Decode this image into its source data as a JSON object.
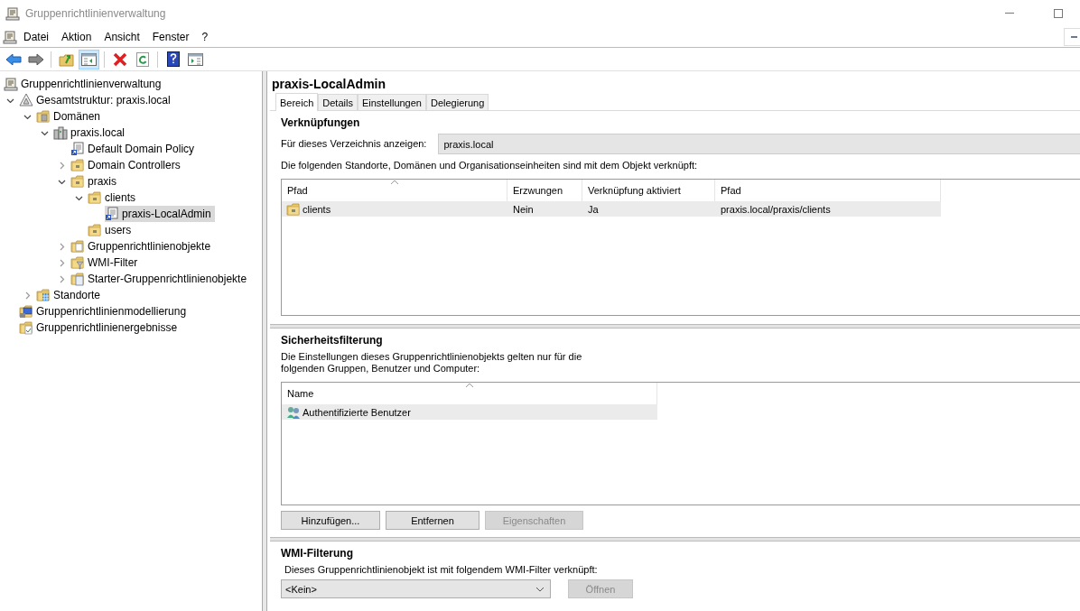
{
  "window": {
    "title": "Gruppenrichtlinienverwaltung"
  },
  "menu": [
    "Datei",
    "Aktion",
    "Ansicht",
    "Fenster",
    "?"
  ],
  "toolbar": [
    {
      "kind": "back",
      "pressed": false
    },
    {
      "kind": "forward",
      "pressed": false
    },
    {
      "kind": "up",
      "pressed": false
    },
    {
      "kind": "tree",
      "pressed": true
    },
    {
      "kind": "delete",
      "pressed": false
    },
    {
      "kind": "refresh",
      "pressed": false
    },
    {
      "kind": "help",
      "pressed": false
    },
    {
      "kind": "pane",
      "pressed": false
    }
  ],
  "tree": {
    "items": [
      {
        "label": "Gruppenrichtlinienverwaltung",
        "kind": "console",
        "selected": false,
        "children": [
          {
            "label": "Gesamtstruktur: praxis.local",
            "kind": "forest",
            "expanded": true,
            "selected": false,
            "children": [
              {
                "label": "Domänen",
                "kind": "domains",
                "expanded": true,
                "selected": false,
                "children": [
                  {
                    "label": "praxis.local",
                    "kind": "domain",
                    "expanded": true,
                    "selected": false,
                    "children": [
                      {
                        "label": "Default Domain Policy",
                        "kind": "link",
                        "selected": false
                      },
                      {
                        "label": "Domain Controllers",
                        "kind": "ou",
                        "expanded": false,
                        "selected": false
                      },
                      {
                        "label": "praxis",
                        "kind": "ou",
                        "expanded": true,
                        "selected": false,
                        "children": [
                          {
                            "label": "clients",
                            "kind": "ou",
                            "expanded": true,
                            "selected": false,
                            "children": [
                              {
                                "label": "praxis-LocalAdmin",
                                "kind": "link",
                                "selected": true
                              }
                            ]
                          },
                          {
                            "label": "users",
                            "kind": "ou",
                            "selected": false
                          }
                        ]
                      },
                      {
                        "label": "Gruppenrichtlinienobjekte",
                        "kind": "gpos",
                        "expanded": false,
                        "selected": false
                      },
                      {
                        "label": "WMI-Filter",
                        "kind": "wmi",
                        "expanded": false,
                        "selected": false
                      },
                      {
                        "label": "Starter-Gruppenrichtlinienobjekte",
                        "kind": "starter",
                        "expanded": false,
                        "selected": false
                      }
                    ]
                  }
                ]
              },
              {
                "label": "Standorte",
                "kind": "sites",
                "expanded": false,
                "selected": false
              }
            ]
          },
          {
            "label": "Gruppenrichtlinienmodellierung",
            "kind": "modeling",
            "selected": false
          },
          {
            "label": "Gruppenrichtlinienergebnisse",
            "kind": "results",
            "selected": false
          }
        ]
      }
    ]
  },
  "details": {
    "title": "praxis-LocalAdmin",
    "tabs": [
      {
        "label": "Bereich",
        "selected": true
      },
      {
        "label": "Details",
        "selected": false
      },
      {
        "label": "Einstellungen",
        "selected": false
      },
      {
        "label": "Delegierung",
        "selected": false
      }
    ],
    "links": {
      "heading": "Verknüpfungen",
      "directory_label": "Für dieses Verzeichnis anzeigen:",
      "directory_value": "praxis.local",
      "description": "Die folgenden Standorte, Domänen und Organisationseinheiten sind mit dem Objekt verknüpft:",
      "columns": [
        {
          "label": "Pfad",
          "sorted": true
        },
        {
          "label": "Erzwungen",
          "sorted": false
        },
        {
          "label": "Verknüpfung aktiviert",
          "sorted": false
        },
        {
          "label": "Pfad",
          "sorted": false
        }
      ],
      "rows": [
        {
          "kind": "ou",
          "selected": true,
          "cells": [
            "clients",
            "Nein",
            "Ja",
            "praxis.local/praxis/clients"
          ]
        }
      ]
    },
    "security": {
      "heading": "Sicherheitsfilterung",
      "description": "Die Einstellungen dieses Gruppenrichtlinienobjekts gelten nur für die folgenden Gruppen, Benutzer und Computer:",
      "columns": [
        {
          "label": "Name",
          "sorted": true
        }
      ],
      "rows": [
        {
          "kind": "users",
          "selected": true,
          "cells": [
            "Authentifizierte Benutzer"
          ]
        }
      ],
      "buttons": [
        {
          "label": "Hinzufügen...",
          "disabled": false
        },
        {
          "label": "Entfernen",
          "disabled": false
        },
        {
          "label": "Eigenschaften",
          "disabled": true
        }
      ]
    },
    "wmi": {
      "heading": "WMI-Filterung",
      "description": "Dieses Gruppenrichtlinienobjekt ist mit folgendem WMI-Filter verknüpft:",
      "value": "<Kein>",
      "button": {
        "label": "Öffnen",
        "disabled": true
      }
    }
  }
}
